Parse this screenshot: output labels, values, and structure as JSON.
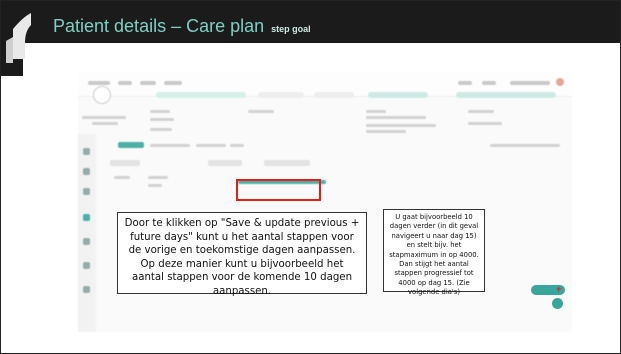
{
  "slide": {
    "title": "Patient details – Care plan",
    "title_suffix": "step goal"
  },
  "callouts": {
    "left": "Door te klikken op \"Save & update previous + future days\" kunt u het aantal stappen voor de vorige en toekomstige dagen aanpassen. Op deze manier kunt u bijvoorbeeld het aantal stappen voor de komende 10 dagen aanpassen.",
    "right": "U gaat bijvoorbeeld 10 dagen verder (in dit geval navigeert u naar dag 15) en stelt bijv. het stapmaximum in op 4000. Dan stijgt het aantal stappen progressief tot 4000 op dag 15. (Zie volgende dia's)"
  },
  "colors": {
    "header_bg": "#1b1b1b",
    "title_color": "#7ecfc4",
    "highlight_red": "#e21e1e",
    "brand_teal": "#4bb0a6"
  },
  "icons": {
    "chat": "chat-icon",
    "logo": "app-logo-icon"
  }
}
